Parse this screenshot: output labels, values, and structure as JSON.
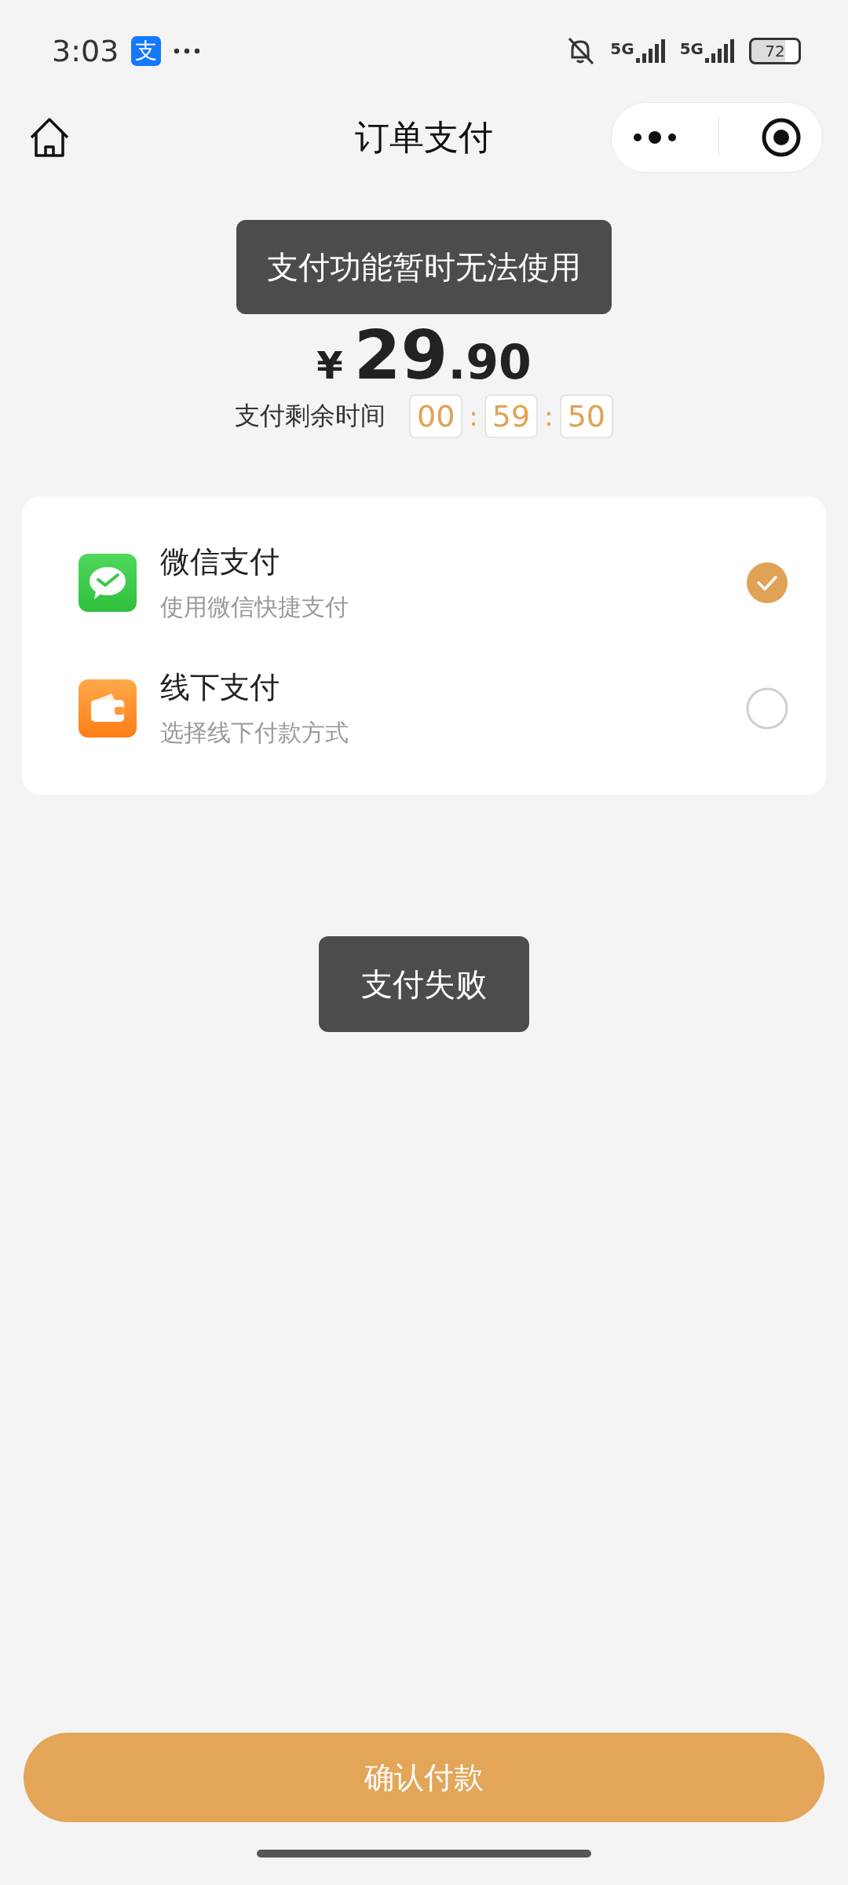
{
  "status_bar": {
    "time": "3:03",
    "app_badge": "支",
    "network_labels": [
      "5G",
      "5G"
    ],
    "battery": "72"
  },
  "nav": {
    "title": "订单支付"
  },
  "toasts": [
    {
      "text": "支付功能暂时无法使用",
      "kind": "top"
    },
    {
      "text": "支付失败",
      "kind": "middle"
    }
  ],
  "price": {
    "symbol": "¥",
    "integer": "29",
    "decimal": ".90"
  },
  "timer": {
    "label": "支付剩余时间",
    "parts": [
      {
        "kind": "digits",
        "text": "00"
      },
      {
        "kind": "separator",
        "text": ":"
      },
      {
        "kind": "digits",
        "text": "59"
      },
      {
        "kind": "separator",
        "text": ":"
      },
      {
        "kind": "digits",
        "text": "50"
      }
    ]
  },
  "methods": [
    {
      "kind": "wechat",
      "name": "微信支付",
      "description": "使用微信快捷支付",
      "selected": true
    },
    {
      "kind": "offline",
      "name": "线下支付",
      "description": "选择线下付款方式",
      "selected": false
    }
  ],
  "confirm_button": "确认付款"
}
